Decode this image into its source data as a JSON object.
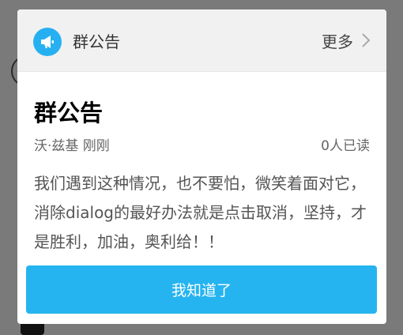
{
  "dialog": {
    "header": {
      "icon": "megaphone-icon",
      "title": "群公告",
      "more_label": "更多",
      "more_icon": "chevron-right-icon"
    },
    "announcement": {
      "title": "群公告",
      "author_time": "沃·兹基 刚刚",
      "read_count": "0人已读",
      "content": "我们遇到这种情况，也不要怕，微笑着面对它，消除dialog的最好办法就是点击取消，坚持，才是胜利，加油，奥利给！！"
    },
    "confirm_label": "我知道了"
  },
  "colors": {
    "accent": "#25b4f0",
    "header_bg": "#f1f1f1",
    "overlay": "#7a7a7a"
  }
}
